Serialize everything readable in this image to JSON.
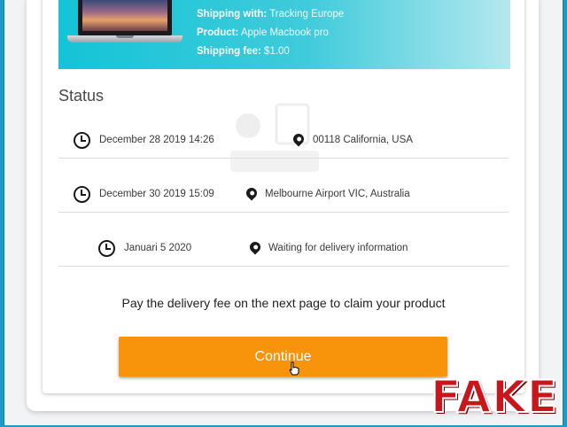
{
  "product_info": {
    "shipping_with_label": "Shipping with:",
    "shipping_with_value": "Tracking Europe",
    "product_label": "Product:",
    "product_value": "Apple Macbook pro",
    "shipping_fee_label": "Shipping fee:",
    "shipping_fee_value": "$1.00"
  },
  "status": {
    "title": "Status",
    "entries": [
      {
        "datetime": "December 28 2019 14:26",
        "location": "00118 California, USA"
      },
      {
        "datetime": "December 30 2019 15:09",
        "location": "Melbourne Airport VIC, Australia"
      },
      {
        "datetime": "Januari 5 2020",
        "location": "Waiting for delivery information"
      }
    ]
  },
  "message": "Pay the delivery fee on the next page to claim your product",
  "continue_label": "Continue",
  "stamp": "FAKE",
  "colors": {
    "page_border": "#1d9bc4",
    "banner_start": "#14c4d6",
    "button": "#f7940c",
    "stamp": "#c8161d"
  }
}
